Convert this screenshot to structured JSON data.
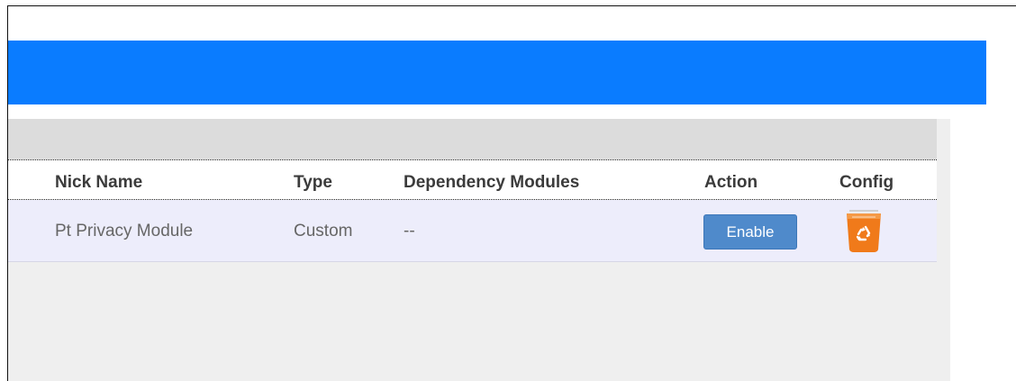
{
  "table": {
    "headers": {
      "nick_name": "Nick Name",
      "type": "Type",
      "dependency": "Dependency Modules",
      "action": "Action",
      "config": "Config"
    },
    "rows": [
      {
        "nick_name": "Pt Privacy Module",
        "type": "Custom",
        "dependency": "--",
        "action_label": "Enable",
        "config_icon": "recycle-bin-icon"
      }
    ]
  },
  "colors": {
    "header_bar": "#0a7cff",
    "toolbar": "#dcdcdc",
    "row_bg": "#ededfb",
    "enable_button": "#4f8acb",
    "trash_icon": "#f07a1a"
  }
}
